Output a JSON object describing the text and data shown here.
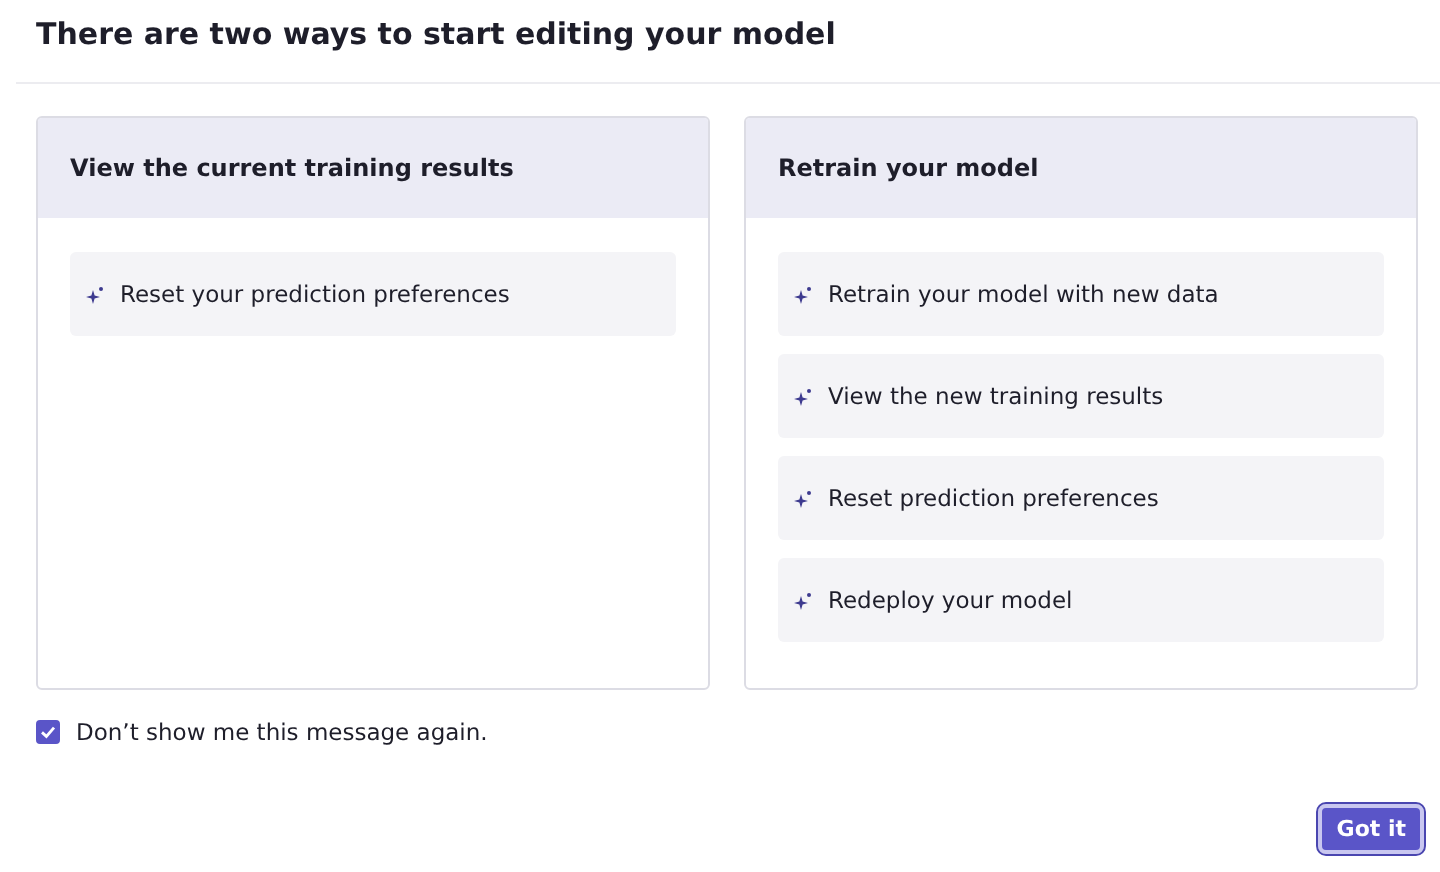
{
  "title": "There are two ways to start editing your model",
  "cards": [
    {
      "heading": "View the current training results",
      "items": [
        "Reset your prediction preferences"
      ]
    },
    {
      "heading": "Retrain your model",
      "items": [
        "Retrain your model with new data",
        "View the new training results",
        "Reset prediction preferences",
        "Redeploy your model"
      ]
    }
  ],
  "checkbox": {
    "label": "Don’t show me this message again.",
    "checked": true
  },
  "button": "Got it"
}
